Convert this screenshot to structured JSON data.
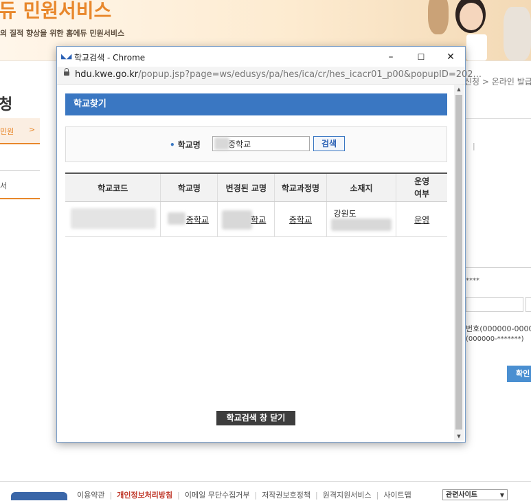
{
  "site": {
    "brand": "듀 민원서비스",
    "tagline": "의 질적 향상을 위한 홈에듀 민원서비스",
    "page_title": "청",
    "breadcrumb": "신청 > 온라인 발급",
    "menu_active": "민원",
    "menu_arrow": ">",
    "menu_item": "서",
    "masked": "****",
    "hint_line1": "번호(000000-00000",
    "hint_line2": "(000000-*******)",
    "confirm_label": "확인"
  },
  "footer": {
    "links": [
      "이용약관",
      "개인정보처리방침",
      "이메일 무단수집거부",
      "저작권보호정책",
      "원격지원서비스",
      "사이트맵"
    ],
    "related_select": "관련사이트"
  },
  "popup": {
    "window_title": "학교검색 - Chrome",
    "url_host": "hdu.kwe.go.kr",
    "url_rest": "/popup.jsp?page=ws/edusys/pa/hes/ica/cr/hes_icacr01_p00&popupID=202...",
    "panel_title": "학교찾기",
    "search_label": "학교명",
    "search_value": "중학교",
    "search_button": "검색",
    "columns": [
      "학교코드",
      "학교명",
      "변경된 교명",
      "학교과정명",
      "소재지",
      "운영 여부"
    ],
    "row": {
      "name": "중학교",
      "changed": "학교",
      "course": "중학교",
      "location": "강원도",
      "status": "운영"
    },
    "close_button": "학교검색 창 닫기",
    "win_minimize": "–",
    "win_maximize": "☐",
    "win_close": "✕"
  }
}
